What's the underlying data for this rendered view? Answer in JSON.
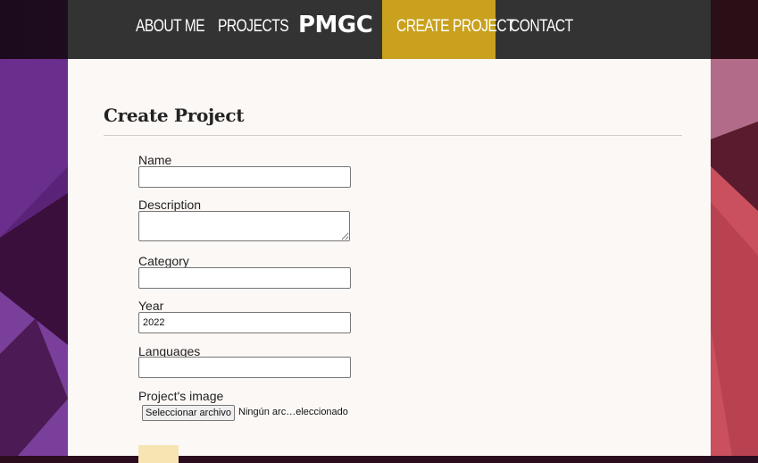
{
  "nav": {
    "about_label": "About me",
    "projects_label": "Projects",
    "logo_text": "PMGC",
    "create_label": "Create Project",
    "contact_label": "Contact",
    "active_color": "#c9a11e",
    "bar_color": "#333333"
  },
  "form": {
    "title": "Create Project",
    "name_label": "Name",
    "name_value": "",
    "description_label": "Description",
    "description_value": "",
    "category_label": "Category",
    "category_value": "",
    "year_label": "Year",
    "year_value": "2022",
    "languages_label": "Languages",
    "languages_value": "",
    "image_label": "Project's image",
    "file_button_label": "Seleccionar archivo",
    "file_status": "Ningún arc…eleccionado",
    "submit_label": ""
  }
}
